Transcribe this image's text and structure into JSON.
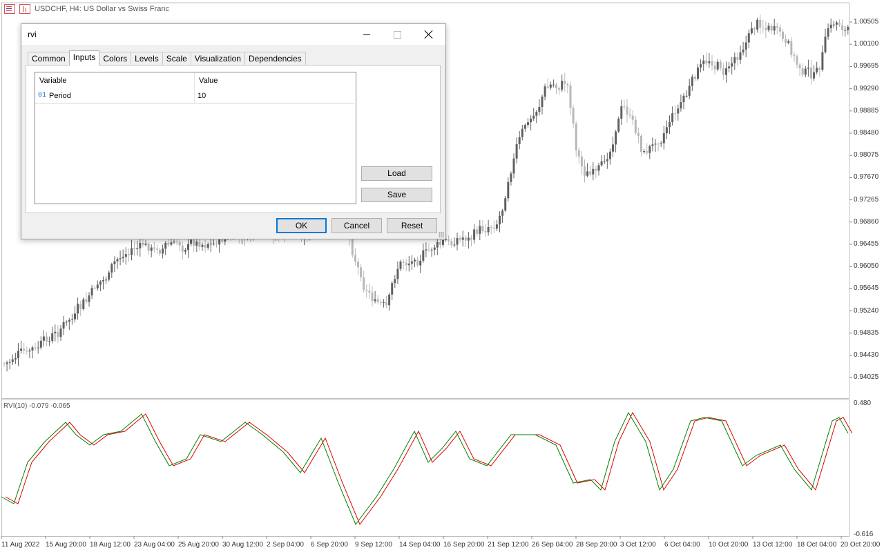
{
  "chart": {
    "symbol_title": "USDCHF, H4:  US Dollar vs Swiss Franc",
    "price_labels": [
      "1.00505",
      "1.00100",
      "0.99695",
      "0.99290",
      "0.98885",
      "0.98480",
      "0.98075",
      "0.97670",
      "0.97265",
      "0.96860",
      "0.96455",
      "0.96050",
      "0.95645",
      "0.95240",
      "0.94835",
      "0.94430",
      "0.94025"
    ],
    "time_labels": [
      "11 Aug 2022",
      "15 Aug 20:00",
      "18 Aug 12:00",
      "23 Aug 04:00",
      "25 Aug 20:00",
      "30 Aug 12:00",
      "2 Sep 04:00",
      "6 Sep 20:00",
      "9 Sep 12:00",
      "14 Sep 04:00",
      "16 Sep 20:00",
      "21 Sep 12:00",
      "26 Sep 04:00",
      "28 Sep 20:00",
      "3 Oct 12:00",
      "6 Oct 04:00",
      "10 Oct 20:00",
      "13 Oct 12:00",
      "18 Oct 04:00",
      "20 Oct 20:00"
    ],
    "rvi_label": "RVI(10) -0.079 -0.065",
    "rvi_max": "0.480",
    "rvi_min": "-0.616",
    "colors": {
      "candle": "#8c8c8c",
      "rvi_main": "#008000",
      "rvi_signal": "#e00000",
      "grid_border": "#c0c0c0"
    }
  },
  "dialog": {
    "title": "rvi",
    "tabs": [
      "Common",
      "Inputs",
      "Colors",
      "Levels",
      "Scale",
      "Visualization",
      "Dependencies"
    ],
    "active_tab": "Inputs",
    "table": {
      "headers": {
        "variable": "Variable",
        "value": "Value"
      },
      "rows": [
        {
          "icon": "01",
          "variable": "Period",
          "value": "10"
        }
      ]
    },
    "buttons": {
      "load": "Load",
      "save": "Save",
      "ok": "OK",
      "cancel": "Cancel",
      "reset": "Reset"
    }
  }
}
